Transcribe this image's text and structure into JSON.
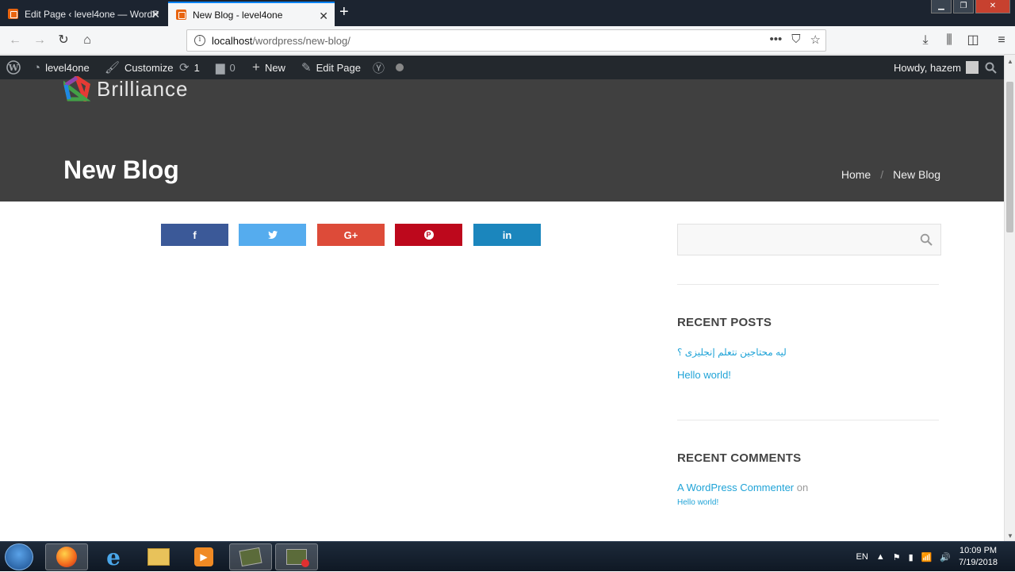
{
  "browser": {
    "tabs": [
      {
        "title": "Edit Page ‹ level4one — WordP"
      },
      {
        "title": "New Blog - level4one"
      }
    ],
    "new_tab": "+",
    "url_host": "localhost",
    "url_path": "/wordpress/new-blog/"
  },
  "admin_bar": {
    "site": "level4one",
    "customize": "Customize",
    "updates_count": "1",
    "comments_count": "0",
    "new": "New",
    "edit_page": "Edit Page",
    "howdy": "Howdy, hazem"
  },
  "site": {
    "logo_text": "Brilliance",
    "page_title": "New Blog",
    "breadcrumb": {
      "home": "Home",
      "sep": "/",
      "current": "New Blog"
    }
  },
  "share_buttons": [
    {
      "icon": "f",
      "color": "#3b5998"
    },
    {
      "icon": "🐦",
      "color": "#55acee"
    },
    {
      "icon": "G+",
      "color": "#dd4b39"
    },
    {
      "icon": "P",
      "color": "#bd081c"
    },
    {
      "icon": "in",
      "color": "#1b86bd"
    }
  ],
  "sidebar": {
    "recent_posts_title": "RECENT POSTS",
    "recent_posts": [
      "ليه محتاجين نتعلم إنجليزى ؟",
      "Hello world!"
    ],
    "recent_comments_title": "RECENT COMMENTS",
    "comment_author": "A WordPress Commenter",
    "comment_on": "on",
    "comment_post": "Hello world!"
  },
  "taskbar": {
    "lang": "EN",
    "time": "10:09 PM",
    "date": "7/19/2018"
  },
  "colors": {
    "accent": "#1fa3d7",
    "hero": "#404040",
    "adminbar": "#23282d"
  }
}
